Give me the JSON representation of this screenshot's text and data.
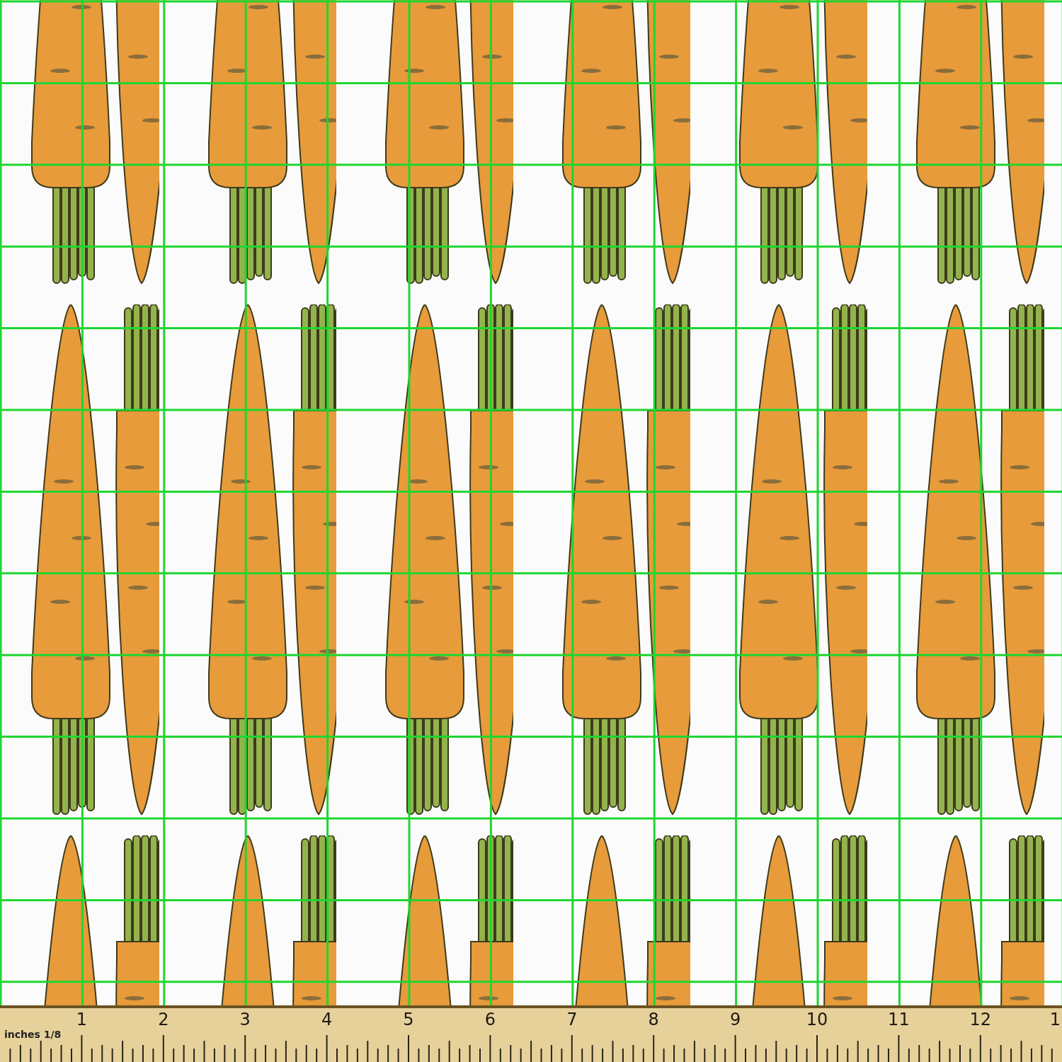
{
  "ruler": {
    "unit_label": "inches 1/8",
    "numbers": [
      "1",
      "2",
      "3",
      "4",
      "5",
      "6",
      "7",
      "8",
      "9",
      "10",
      "11",
      "12",
      "1"
    ]
  }
}
